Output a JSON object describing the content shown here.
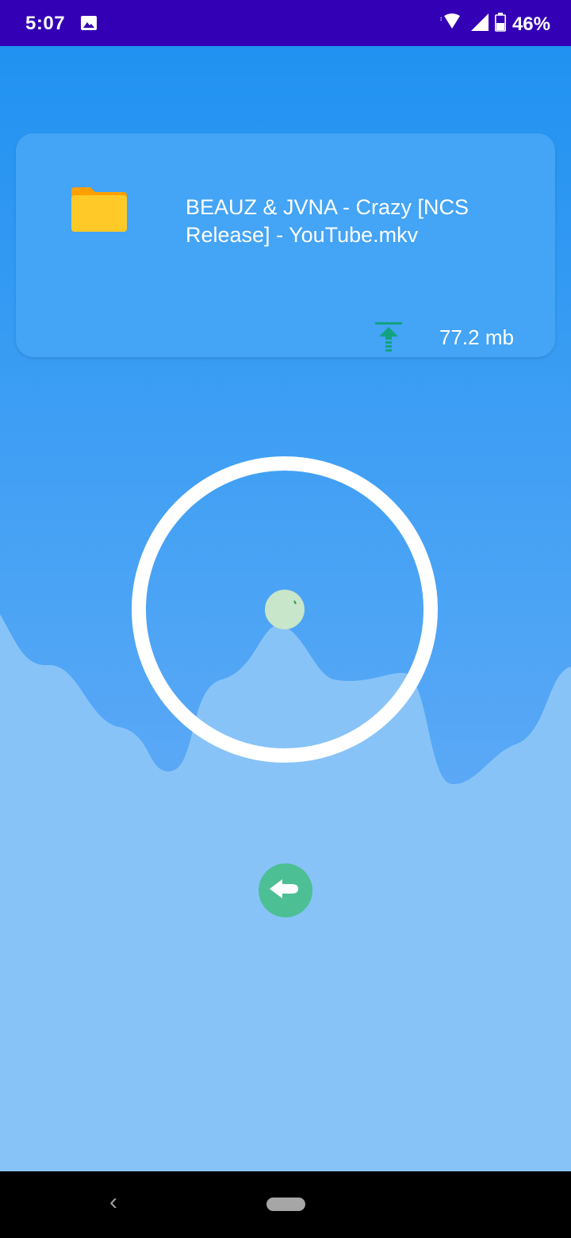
{
  "status_bar": {
    "time": "5:07",
    "battery": "46%",
    "icons": [
      "image-icon",
      "wifi-icon",
      "signal-icon",
      "battery-icon"
    ]
  },
  "file": {
    "name": "BEAUZ & JVNA - Crazy [NCS Release] - YouTube.mkv",
    "size": "77.2 mb",
    "icon": "folder-icon",
    "status_icon": "upload-icon"
  },
  "transfer": {
    "progress_percent": 0,
    "ring_color": "#ffffff",
    "center_dot_color": "#c8e6c9"
  },
  "actions": {
    "back_icon": "arrow-left-icon",
    "back_color": "#4dbf95"
  },
  "nav_bar": {
    "back_icon": "chevron-left-icon",
    "home_icon": "home-pill-icon"
  },
  "colors": {
    "status_bar": "#3300b5",
    "background_top": "#2192f1",
    "wave_fill": "#88c3f8",
    "card": "#44a4f5",
    "upload_accent": "#11a37f"
  }
}
